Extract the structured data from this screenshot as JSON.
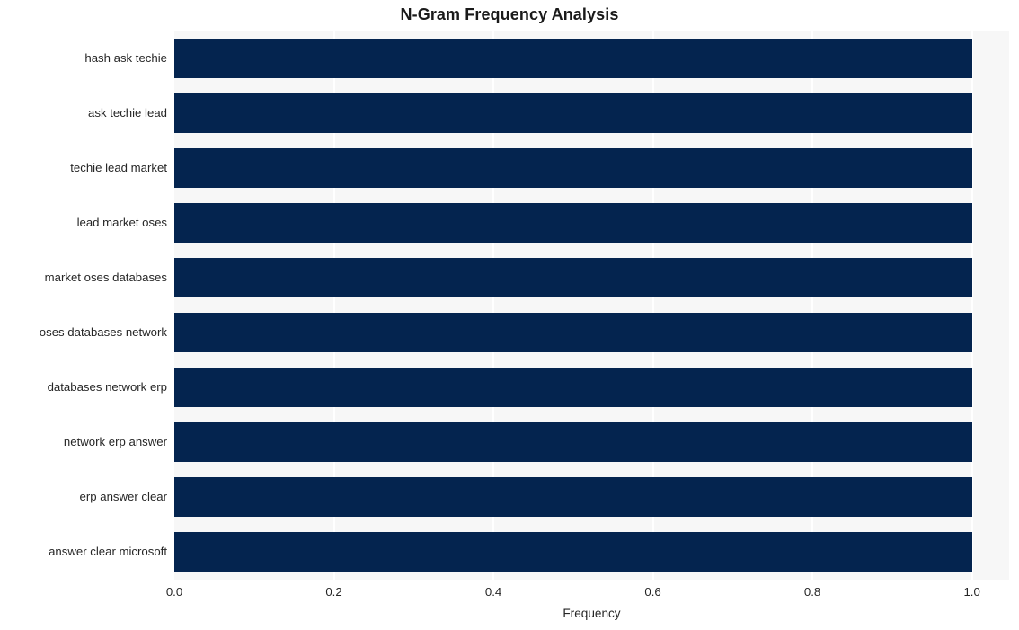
{
  "chart_data": {
    "type": "bar",
    "orientation": "horizontal",
    "title": "N-Gram Frequency Analysis",
    "xlabel": "Frequency",
    "ylabel": "",
    "categories": [
      "hash ask techie",
      "ask techie lead",
      "techie lead market",
      "lead market oses",
      "market oses databases",
      "oses databases network",
      "databases network erp",
      "network erp answer",
      "erp answer clear",
      "answer clear microsoft"
    ],
    "values": [
      1.0,
      1.0,
      1.0,
      1.0,
      1.0,
      1.0,
      1.0,
      1.0,
      1.0,
      1.0
    ],
    "xlim": [
      0.0,
      1.0466
    ],
    "x_ticks": [
      0.0,
      0.2,
      0.4,
      0.6,
      0.8,
      1.0
    ],
    "x_tick_labels": [
      "0.0",
      "0.2",
      "0.4",
      "0.6",
      "0.8",
      "1.0"
    ],
    "grid": true,
    "grid_axis": "x",
    "legend": null,
    "bar_color": "#04244f",
    "plot_background": "#f7f7f7",
    "figure_background": "#ffffff",
    "gridline_color": "#ffffff",
    "text_color": "#262626",
    "title_color": "#1a1a1a"
  }
}
